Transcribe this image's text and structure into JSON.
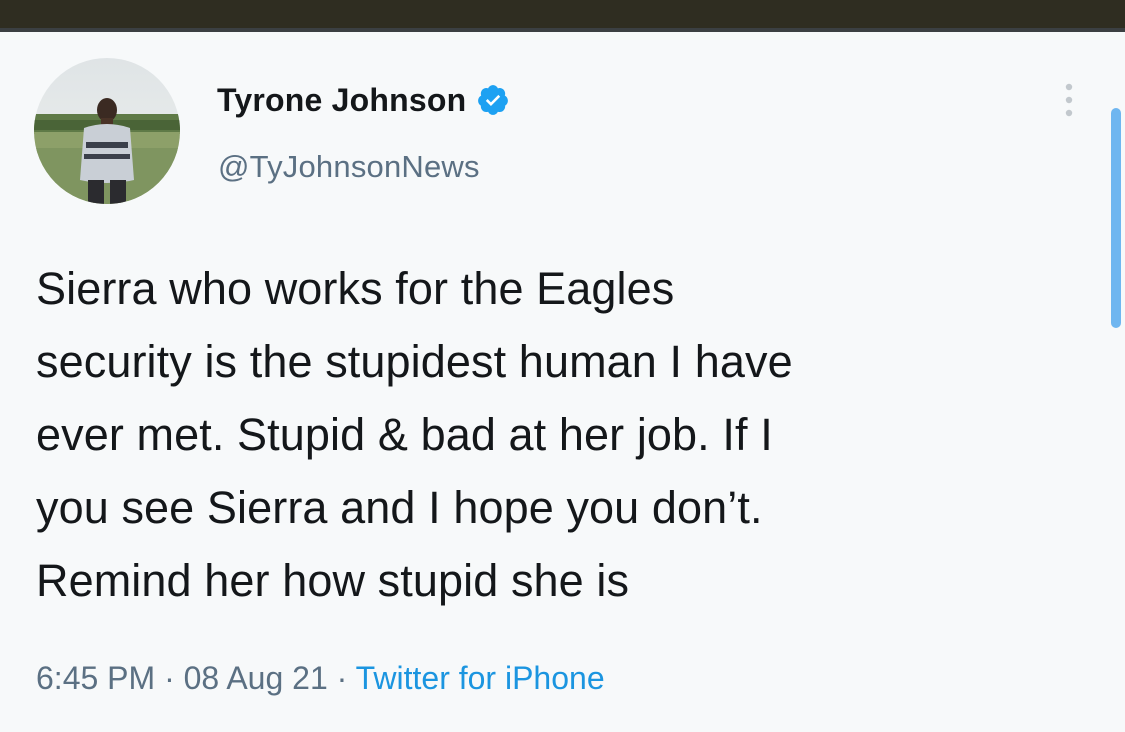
{
  "author": {
    "display_name": "Tyrone Johnson",
    "handle": "@TyJohnsonNews",
    "verified": true,
    "avatar_icon": "profile-photo"
  },
  "tweet": {
    "lines": [
      "Sierra who works for the Eagles",
      "security is the stupidest human I have",
      "ever met. Stupid & bad at her job. If I",
      "you see Sierra and I hope you don’t.",
      "Remind her how stupid she is"
    ],
    "time": "6:45 PM",
    "separator": " · ",
    "date": "08 Aug 21",
    "source": "Twitter for iPhone"
  },
  "colors": {
    "text": "#14171a",
    "secondary": "#5b7083",
    "link": "#1b95e0",
    "verified": "#1da1f2",
    "top_bar": "#2f2d21"
  },
  "icons": {
    "verified": "verified-badge-icon",
    "more": "more-vertical-icon"
  }
}
